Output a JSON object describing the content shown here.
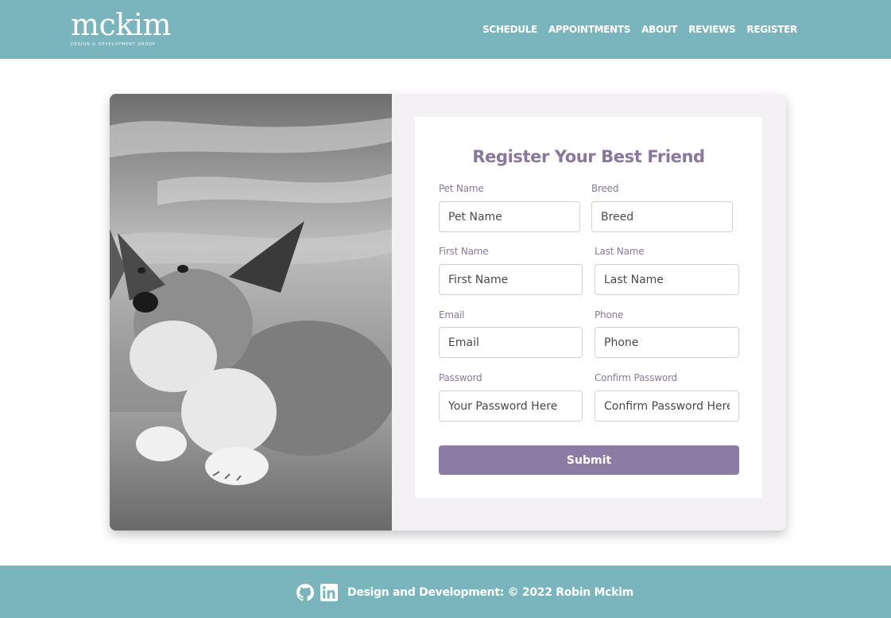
{
  "brand": {
    "name": "mckim",
    "tagline": "DESIGN & DEVELOPMENT GROUP"
  },
  "nav": {
    "items": [
      {
        "label": "SCHEDULE"
      },
      {
        "label": "APPOINTMENTS"
      },
      {
        "label": "ABOUT"
      },
      {
        "label": "REVIEWS"
      },
      {
        "label": "REGISTER"
      }
    ]
  },
  "form": {
    "title": "Register Your Best Friend",
    "pet_name": {
      "label": "Pet Name",
      "placeholder": "Pet Name",
      "value": ""
    },
    "breed": {
      "label": "Breed",
      "placeholder": "Breed",
      "value": ""
    },
    "first_name": {
      "label": "First Name",
      "placeholder": "First Name",
      "value": ""
    },
    "last_name": {
      "label": "Last Name",
      "placeholder": "Last Name",
      "value": ""
    },
    "email": {
      "label": "Email",
      "placeholder": "Email",
      "value": ""
    },
    "phone": {
      "label": "Phone",
      "placeholder": "Phone",
      "value": ""
    },
    "password": {
      "label": "Password",
      "placeholder": "Your Password Here",
      "value": ""
    },
    "confirm_password": {
      "label": "Confirm Password",
      "placeholder": "Confirm Password Here",
      "value": ""
    },
    "submit_label": "Submit"
  },
  "footer": {
    "icons": [
      "github-icon",
      "linkedin-icon"
    ],
    "text": "Design and Development: © 2022 Robin Mckim"
  },
  "colors": {
    "header_bg": "#7ab4bc",
    "accent": "#8c7ca3",
    "label": "#8a789c",
    "card_bg": "#f4f1f5"
  }
}
